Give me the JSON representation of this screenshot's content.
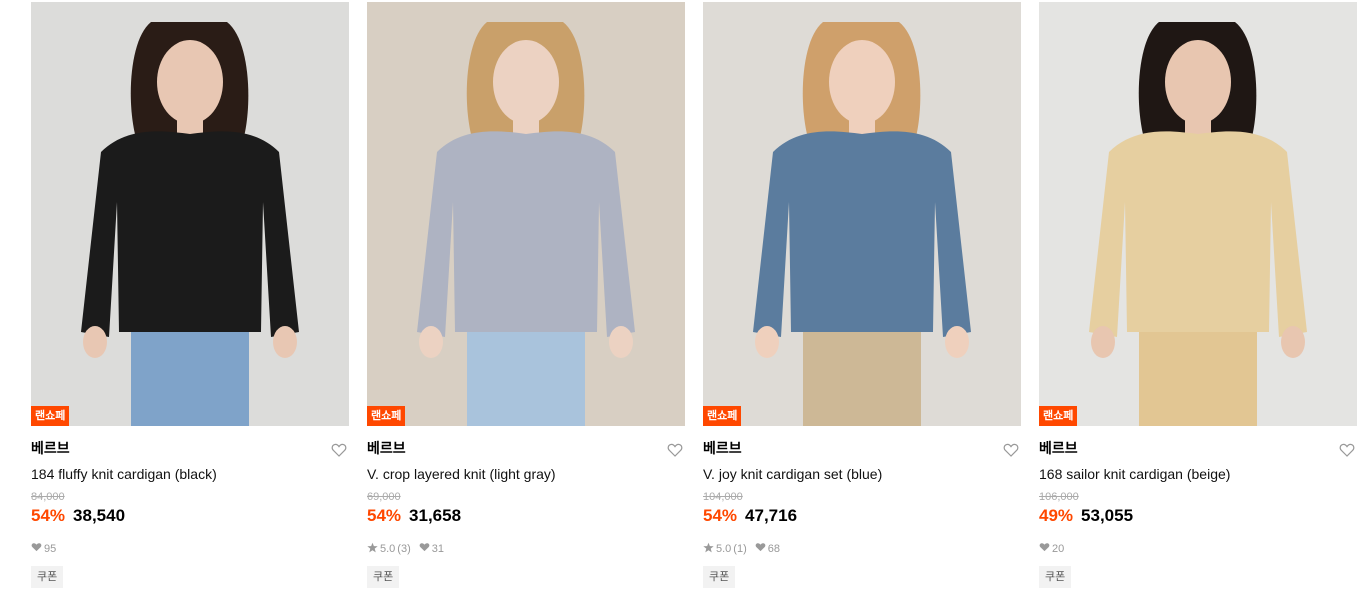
{
  "products": [
    {
      "badge": "랜쇼페",
      "brand": "베르브",
      "name": "184 fluffy knit cardigan (black)",
      "original_price": "84,000",
      "discount": "54%",
      "price": "38,540",
      "rating": "",
      "review_count": "",
      "likes": "95",
      "coupon": "쿠폰",
      "colors": {
        "bg": "#dcdcda",
        "garment": "#1b1b1b",
        "bottom": "#7fa3c9",
        "skin": "#e8c7b3",
        "hair": "#2a1c16"
      }
    },
    {
      "badge": "랜쇼페",
      "brand": "베르브",
      "name": "V. crop layered knit (light gray)",
      "original_price": "69,000",
      "discount": "54%",
      "price": "31,658",
      "rating": "5.0",
      "review_count": "(3)",
      "likes": "31",
      "coupon": "쿠폰",
      "colors": {
        "bg": "#d8cfc3",
        "garment": "#aeb3c2",
        "bottom": "#a9c3dc",
        "skin": "#ecd2c2",
        "hair": "#c9a06a"
      }
    },
    {
      "badge": "랜쇼페",
      "brand": "베르브",
      "name": "V. joy knit cardigan set (blue)",
      "original_price": "104,000",
      "discount": "54%",
      "price": "47,716",
      "rating": "5.0",
      "review_count": "(1)",
      "likes": "68",
      "coupon": "쿠폰",
      "colors": {
        "bg": "#dedbd6",
        "garment": "#5b7c9e",
        "bottom": "#cdb896",
        "skin": "#efd0bd",
        "hair": "#cfa06b"
      }
    },
    {
      "badge": "랜쇼페",
      "brand": "베르브",
      "name": "168 sailor knit cardigan (beige)",
      "original_price": "106,000",
      "discount": "49%",
      "price": "53,055",
      "rating": "",
      "review_count": "",
      "likes": "20",
      "coupon": "쿠폰",
      "colors": {
        "bg": "#e4e4e2",
        "garment": "#e6cfa0",
        "bottom": "#e2c693",
        "skin": "#e8c6b0",
        "hair": "#1f1714"
      }
    }
  ]
}
